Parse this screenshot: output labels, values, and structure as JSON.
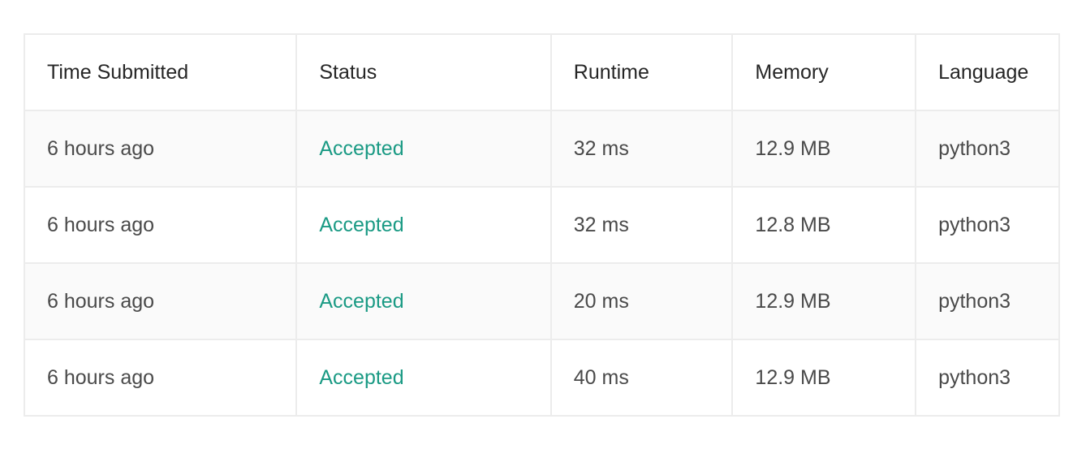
{
  "columns": [
    "Time Submitted",
    "Status",
    "Runtime",
    "Memory",
    "Language"
  ],
  "colors": {
    "accepted": "#1a9a84"
  },
  "rows": [
    {
      "time": "6 hours ago",
      "status": "Accepted",
      "runtime": "32 ms",
      "memory": "12.9 MB",
      "language": "python3"
    },
    {
      "time": "6 hours ago",
      "status": "Accepted",
      "runtime": "32 ms",
      "memory": "12.8 MB",
      "language": "python3"
    },
    {
      "time": "6 hours ago",
      "status": "Accepted",
      "runtime": "20 ms",
      "memory": "12.9 MB",
      "language": "python3"
    },
    {
      "time": "6 hours ago",
      "status": "Accepted",
      "runtime": "40 ms",
      "memory": "12.9 MB",
      "language": "python3"
    }
  ]
}
